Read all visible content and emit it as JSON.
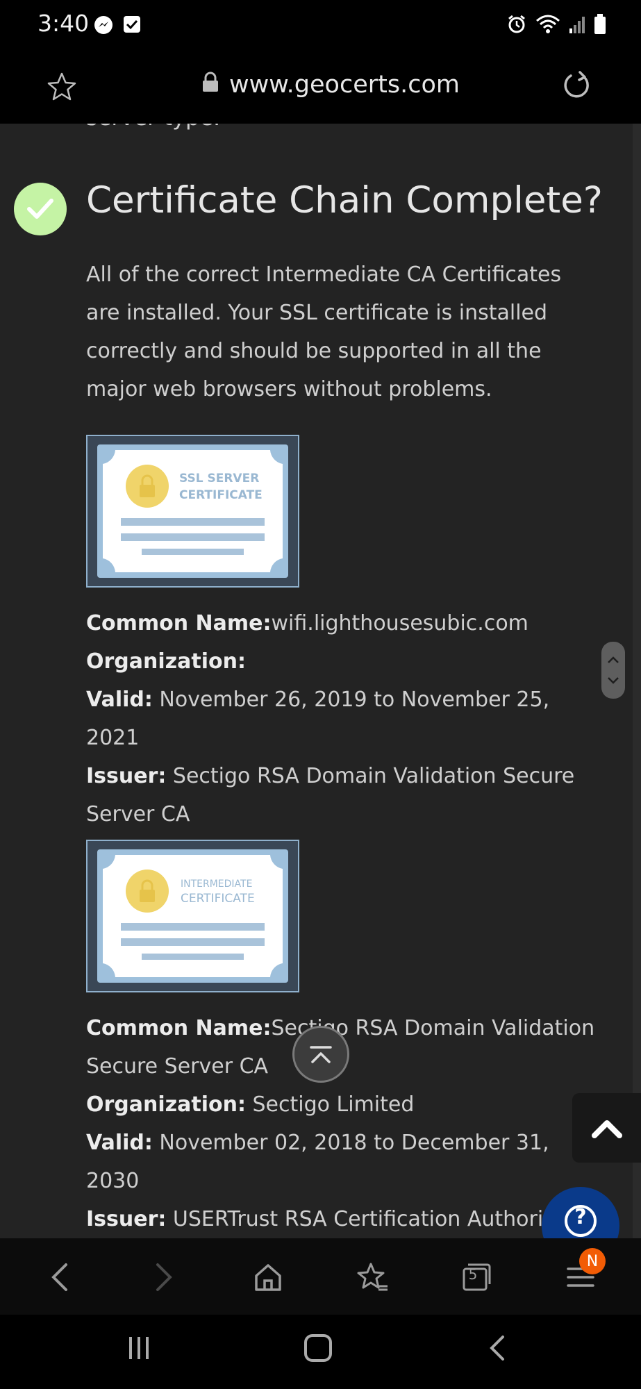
{
  "status_bar": {
    "time": "3:40",
    "left_icons": [
      "messenger-icon",
      "checkbox-notification-icon"
    ],
    "right_icons": [
      "alarm-icon",
      "wifi-icon",
      "signal-icon",
      "battery-icon"
    ]
  },
  "browser": {
    "url": "www.geocerts.com",
    "icons": [
      "star-icon",
      "lock-icon",
      "reload-icon"
    ]
  },
  "page": {
    "cut_text": "server type.",
    "section": {
      "title": "Certificate Chain Complete?",
      "description": "All of the correct Intermediate CA Certificates are installed. Your SSL certificate is installed correctly and should be supported in all the major web browsers without problems."
    },
    "labels": {
      "common_name": "Common Name:",
      "organization": "Organization:",
      "valid": "Valid:",
      "issuer": "Issuer:"
    },
    "certificates": [
      {
        "image_line1": "SSL SERVER",
        "image_line2": "CERTIFICATE",
        "common_name": "wifi.lighthousesubic.com",
        "organization": "",
        "valid": "November 26, 2019 to November 25, 2021",
        "issuer": "Sectigo RSA Domain Validation Secure Server CA"
      },
      {
        "image_line1": "INTERMEDIATE",
        "image_line2": "CERTIFICATE",
        "common_name": "Sectigo RSA Domain Validation Secure Server CA",
        "organization": "Sectigo Limited",
        "valid": "November 02, 2018 to December 31, 2030",
        "issuer": "USERTrust RSA Certification Authority"
      }
    ],
    "help_label": "?"
  },
  "toolbar": {
    "tabs_count": "5",
    "menu_badge": "N"
  },
  "colors": {
    "check_green": "#c5f3a5",
    "help_blue": "#0a3a8a",
    "badge_orange": "#f25c05",
    "page_bg": "#232323"
  }
}
